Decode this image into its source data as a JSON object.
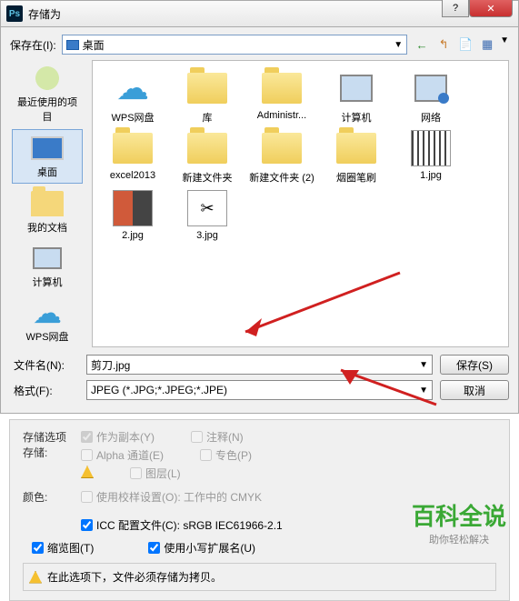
{
  "titlebar": {
    "title": "存储为",
    "app_icon": "Ps"
  },
  "win_buttons": {
    "help": "?",
    "close": "✕"
  },
  "location_bar": {
    "label": "保存在(I):",
    "value": "桌面",
    "nav": {
      "back": "←",
      "up": "↰",
      "new": "📄",
      "view": "▦"
    }
  },
  "sidebar": [
    {
      "label": "最近使用的项目",
      "icon": "clock"
    },
    {
      "label": "桌面",
      "icon": "desktop",
      "active": true
    },
    {
      "label": "我的文档",
      "icon": "folder"
    },
    {
      "label": "计算机",
      "icon": "computer"
    },
    {
      "label": "WPS网盘",
      "icon": "cloud"
    }
  ],
  "files": [
    {
      "label": "WPS网盘",
      "type": "cloud"
    },
    {
      "label": "库",
      "type": "folder-lib"
    },
    {
      "label": "Administr...",
      "type": "folder-user"
    },
    {
      "label": "计算机",
      "type": "computer"
    },
    {
      "label": "网络",
      "type": "network"
    },
    {
      "label": "excel2013",
      "type": "folder"
    },
    {
      "label": "新建文件夹",
      "type": "folder"
    },
    {
      "label": "新建文件夹 (2)",
      "type": "folder"
    },
    {
      "label": "烟圈笔刷",
      "type": "folder"
    },
    {
      "label": "1.jpg",
      "type": "image-lines"
    },
    {
      "label": "2.jpg",
      "type": "image-color"
    },
    {
      "label": "3.jpg",
      "type": "image-scissors"
    }
  ],
  "form": {
    "filename_label": "文件名(N):",
    "filename_value": "剪刀.jpg",
    "format_label": "格式(F):",
    "format_value": "JPEG (*.JPG;*.JPEG;*.JPE)",
    "save_btn": "保存(S)",
    "cancel_btn": "取消"
  },
  "options": {
    "section_title": "存储选项",
    "storage_label": "存储:",
    "checks": {
      "as_copy": "作为副本(Y)",
      "notes": "注释(N)",
      "alpha": "Alpha 通道(E)",
      "spot": "专色(P)",
      "layers": "图层(L)"
    },
    "color_label": "颜色:",
    "color_proof": "使用校样设置(O): 工作中的 CMYK",
    "color_icc": "ICC 配置文件(C): sRGB IEC61966-2.1",
    "thumbnail": "缩览图(T)",
    "lowercase_ext": "使用小写扩展名(U)",
    "warning_text": "在此选项下，文件必须存储为拷贝。"
  },
  "watermark": {
    "title": "百科全说",
    "subtitle": "助你轻松解决"
  }
}
